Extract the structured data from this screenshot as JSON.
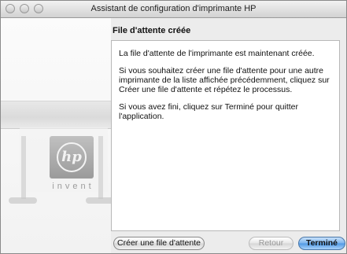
{
  "window": {
    "title": "Assistant de configuration d'imprimante HP"
  },
  "sidebar": {
    "logo_text": "hp",
    "logo_tagline": "invent"
  },
  "main": {
    "heading": "File d'attente créée",
    "paragraphs": [
      "La file d'attente de l'imprimante est maintenant créée.",
      "Si vous souhaitez créer une file d'attente pour une autre imprimante de la liste affichée précédemment, cliquez sur Créer une file d'attente et répétez le processus.",
      "Si vous avez fini, cliquez sur Terminé pour quitter l'application."
    ]
  },
  "buttons": {
    "create": "Créer une file d'attente",
    "back": "Retour",
    "done": "Terminé"
  }
}
